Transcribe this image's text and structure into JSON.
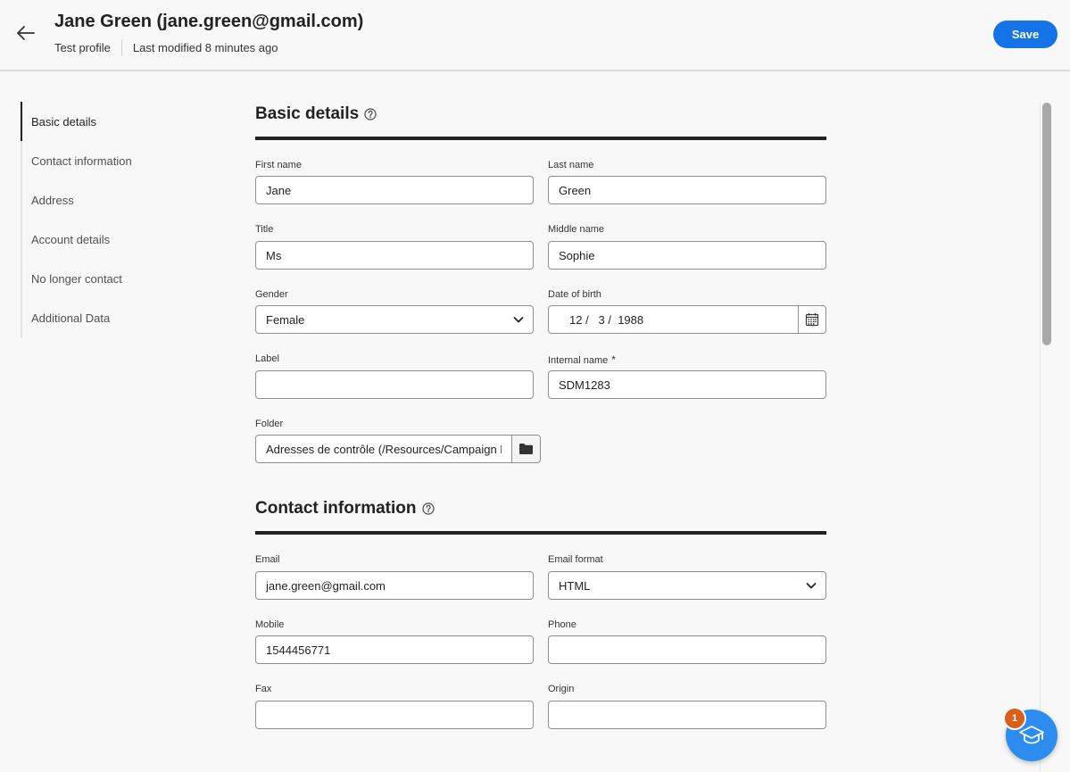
{
  "header": {
    "title": "Jane Green (jane.green@gmail.com)",
    "profile_type": "Test profile",
    "last_modified": "Last modified 8 minutes ago",
    "save_label": "Save"
  },
  "nav": {
    "items": [
      {
        "label": "Basic details",
        "active": true
      },
      {
        "label": "Contact information"
      },
      {
        "label": "Address"
      },
      {
        "label": "Account details"
      },
      {
        "label": "No longer contact"
      },
      {
        "label": "Additional Data"
      }
    ]
  },
  "basic_details": {
    "title": "Basic details",
    "first_name": {
      "label": "First name",
      "value": "Jane"
    },
    "last_name": {
      "label": "Last name",
      "value": "Green"
    },
    "title_field": {
      "label": "Title",
      "value": "Ms"
    },
    "middle_name": {
      "label": "Middle name",
      "value": "Sophie"
    },
    "gender": {
      "label": "Gender",
      "value": "Female"
    },
    "date_of_birth": {
      "label": "Date of birth",
      "value": "12 /   3 /  1988"
    },
    "label_field": {
      "label": "Label",
      "value": ""
    },
    "internal_name": {
      "label": "Internal name",
      "required_mark": "*",
      "value": "SDM1283"
    },
    "folder": {
      "label": "Folder",
      "value": "Adresses de contrôle (/Resources/Campaign Management/"
    }
  },
  "contact_information": {
    "title": "Contact information",
    "email": {
      "label": "Email",
      "value": "jane.green@gmail.com"
    },
    "email_format": {
      "label": "Email format",
      "value": "HTML"
    },
    "mobile": {
      "label": "Mobile",
      "value": "1544456771"
    },
    "phone": {
      "label": "Phone",
      "value": ""
    },
    "fax": {
      "label": "Fax",
      "value": ""
    },
    "origin": {
      "label": "Origin",
      "value": ""
    }
  },
  "help_fab": {
    "badge_count": "1"
  },
  "colors": {
    "accent": "#1473e6",
    "badge": "#d9601a",
    "fab": "#2d8cf0"
  }
}
